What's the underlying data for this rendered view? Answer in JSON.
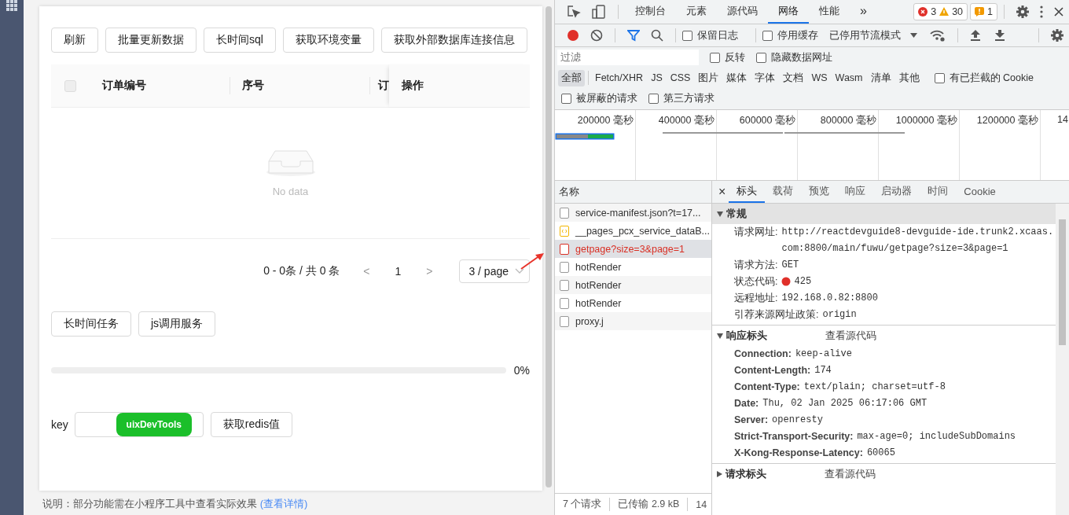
{
  "app": {
    "toolbar_buttons": [
      "刷新",
      "批量更新数据",
      "长时间sql",
      "获取环境变量",
      "获取外部数据库连接信息"
    ],
    "table": {
      "select_all_checked": false,
      "columns": [
        "订单编号",
        "序号",
        "订",
        "操作"
      ],
      "empty_text": "No data"
    },
    "pagination": {
      "summary": "0 - 0条 / 共 0 条",
      "prev": "<",
      "page": "1",
      "next": ">",
      "page_size": "3 / page"
    },
    "task_buttons": [
      "长时间任务",
      "js调用服务"
    ],
    "progress": {
      "level": 0,
      "reading": "0%"
    },
    "redis": {
      "label": "key",
      "badge": "uixDevTools",
      "button": "获取redis值"
    },
    "note": {
      "text": "说明：部分功能需在小程序工具中查看实际效果",
      "link": "(查看详情)"
    }
  },
  "devtools": {
    "tabs": [
      {
        "label": "控制台",
        "selected": false
      },
      {
        "label": "元素",
        "selected": false
      },
      {
        "label": "源代码",
        "selected": false
      },
      {
        "label": "网络",
        "selected": true
      },
      {
        "label": "性能",
        "selected": false
      }
    ],
    "more": "»",
    "errors": "3",
    "warnings": "30",
    "issues": "1",
    "recording": true,
    "preserve_log": {
      "label": "保留日志",
      "checked": false
    },
    "disable_cache": {
      "label": "停用缓存",
      "checked": false
    },
    "throttle": "已停用节流模式",
    "filter": {
      "placeholder": "过滤"
    },
    "invert": {
      "label": "反转",
      "checked": false
    },
    "hide_data_urls": {
      "label": "隐藏数据网址",
      "checked": false
    },
    "type_filters": [
      {
        "label": "全部",
        "selected": true
      },
      {
        "label": "Fetch/XHR",
        "selected": false
      },
      {
        "label": "JS",
        "selected": false
      },
      {
        "label": "CSS",
        "selected": false
      },
      {
        "label": "图片",
        "selected": false
      },
      {
        "label": "媒体",
        "selected": false
      },
      {
        "label": "字体",
        "selected": false
      },
      {
        "label": "文档",
        "selected": false
      },
      {
        "label": "WS",
        "selected": false
      },
      {
        "label": "Wasm",
        "selected": false
      },
      {
        "label": "清单",
        "selected": false
      },
      {
        "label": "其他",
        "selected": false
      }
    ],
    "blocked_cookies": {
      "label": "有已拦截的 Cookie",
      "checked": false
    },
    "blocked_requests": {
      "label": "被屏蔽的请求",
      "checked": false
    },
    "third_party": {
      "label": "第三方请求",
      "checked": false
    },
    "timeline": {
      "ticks": [
        "200000 毫秒",
        "400000 毫秒",
        "600000 毫秒",
        "800000 毫秒",
        "1000000 毫秒",
        "1200000 毫秒",
        "14"
      ]
    },
    "requests": {
      "header": "名称",
      "items": [
        {
          "name": "service-manifest.json?t=17...",
          "kind": "doc",
          "selected": false,
          "error": false
        },
        {
          "name": "__pages_pcx_service_dataB...",
          "kind": "script",
          "selected": false,
          "error": false
        },
        {
          "name": "getpage?size=3&page=1",
          "kind": "doc",
          "selected": true,
          "error": true
        },
        {
          "name": "hotRender",
          "kind": "doc",
          "selected": false,
          "error": false
        },
        {
          "name": "hotRender",
          "kind": "doc",
          "selected": false,
          "error": false
        },
        {
          "name": "hotRender",
          "kind": "doc",
          "selected": false,
          "error": false
        },
        {
          "name": "proxy.j",
          "kind": "doc",
          "selected": false,
          "error": false
        }
      ]
    },
    "status_bar": [
      "7 个请求",
      "已传输 2.9 kB",
      "14"
    ],
    "detail_close": "×",
    "detail_tabs": [
      {
        "label": "标头",
        "selected": true
      },
      {
        "label": "载荷",
        "selected": false
      },
      {
        "label": "预览",
        "selected": false
      },
      {
        "label": "响应",
        "selected": false
      },
      {
        "label": "启动器",
        "selected": false
      },
      {
        "label": "时间",
        "selected": false
      },
      {
        "label": "Cookie",
        "selected": false
      }
    ],
    "general": {
      "title": "常规",
      "rows": [
        {
          "name": "请求网址:",
          "value": "http://reactdevguide8-devguide-ide.trunk2.xcaas.com:8800/main/fuwu/getpage?size=3&page=1",
          "kind": "text"
        },
        {
          "name": "请求方法:",
          "value": "GET",
          "kind": "text"
        },
        {
          "name": "状态代码:",
          "value": "425",
          "kind": "status"
        },
        {
          "name": "远程地址:",
          "value": "192.168.0.82:8800",
          "kind": "text"
        },
        {
          "name": "引荐来源网址政策:",
          "value": "origin",
          "kind": "text"
        }
      ]
    },
    "response_headers": {
      "title": "响应标头",
      "view_source": "查看源代码",
      "rows": [
        {
          "name": "Connection:",
          "value": "keep-alive"
        },
        {
          "name": "Content-Length:",
          "value": "174"
        },
        {
          "name": "Content-Type:",
          "value": "text/plain; charset=utf-8"
        },
        {
          "name": "Date:",
          "value": "Thu, 02 Jan 2025 06:17:06 GMT"
        },
        {
          "name": "Server:",
          "value": "openresty"
        },
        {
          "name": "Strict-Transport-Security:",
          "value": "max-age=0; includeSubDomains"
        },
        {
          "name": "X-Kong-Response-Latency:",
          "value": "60065"
        }
      ]
    },
    "request_headers": {
      "title": "请求标头",
      "view_source": "查看源代码"
    }
  }
}
